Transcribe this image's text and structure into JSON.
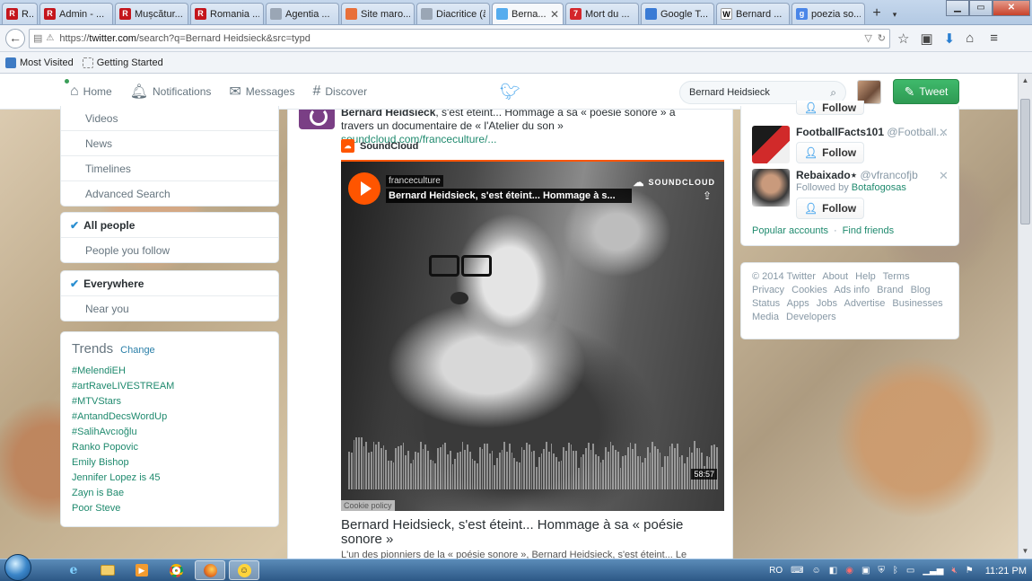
{
  "browser": {
    "tabs": [
      {
        "title": "R...",
        "color": "#c4151c",
        "glyph": "R"
      },
      {
        "title": "Admin - ...",
        "color": "#c4151c",
        "glyph": "R"
      },
      {
        "title": "Mușcătur...",
        "color": "#c4151c",
        "glyph": "R"
      },
      {
        "title": "Romania ...",
        "color": "#c4151c",
        "glyph": "R"
      },
      {
        "title": "Agentia ...",
        "color": "#9aa6b5",
        "glyph": ""
      },
      {
        "title": "Site maro...",
        "color": "#e8703a",
        "glyph": ""
      },
      {
        "title": "Diacritice (ăâî...",
        "color": "#9aa6b5",
        "glyph": ""
      },
      {
        "title": "Berna...",
        "color": "#55acee",
        "glyph": "",
        "active": true
      },
      {
        "title": "Mort du ...",
        "color": "#d4262b",
        "glyph": "7"
      },
      {
        "title": "Google T...",
        "color": "#3a7bd5",
        "glyph": ""
      },
      {
        "title": "Bernard ...",
        "color": "#ffffff",
        "glyph": "W"
      },
      {
        "title": "poezia so...",
        "color": "#4a86e8",
        "glyph": "g"
      }
    ],
    "url_prefix": "https://",
    "url_host": "twitter.com",
    "url_rest": "/search?q=Bernard Heidsieck&src=typd",
    "bookmarks": [
      "Most Visited",
      "Getting Started"
    ]
  },
  "twitter": {
    "nav": {
      "home": "Home",
      "notifications": "Notifications",
      "messages": "Messages",
      "discover": "Discover"
    },
    "search_value": "Bernard Heidsieck",
    "tweet_button": "Tweet",
    "filters_top": [
      "Videos",
      "News",
      "Timelines",
      "Advanced Search"
    ],
    "people_filter": {
      "selected": "All people",
      "other": "People you follow"
    },
    "location_filter": {
      "selected": "Everywhere",
      "other": "Near you"
    },
    "trends": {
      "title": "Trends",
      "change": "Change",
      "items": [
        "#MelendiEH",
        "#artRaveLIVESTREAM",
        "#MTVStars",
        "#AntandDecsWordUp",
        "#SalihAvcıoğlu",
        "Ranko Popovic",
        "Emily Bishop",
        "Jennifer Lopez is 45",
        "Zayn is Bae",
        "Poor Steve"
      ]
    },
    "tweet": {
      "name": "Bernard Heidsieck",
      "text": ", s'est éteint... Hommage à sa « poésie sonore » à travers un documentaire de « l'Atelier du son » ",
      "link": "soundcloud.com/franceculture/...",
      "source_label": "SoundCloud",
      "player": {
        "user": "franceculture",
        "title": "Bernard Heidsieck, s'est éteint... Hommage à s...",
        "brand": "SOUNDCLOUD",
        "duration": "58:57",
        "cookie": "Cookie policy"
      },
      "card_title": "Bernard Heidsieck, s'est éteint... Hommage à sa « poésie sonore »",
      "card_desc": "L'un des pionniers de la « poésie sonore », Bernard Heidsieck, s'est éteint... Le"
    },
    "who_to_follow": {
      "partial_follow": "Follow",
      "items": [
        {
          "name": "FootballFacts101",
          "handle": "@Football...",
          "follow": "Follow"
        },
        {
          "name": "Rebaixado⋆",
          "handle": "@vfrancofjb",
          "followed_by_prefix": "Followed by",
          "followed_by": "Botafogosas",
          "follow": "Follow"
        }
      ],
      "popular": "Popular accounts",
      "find": "Find friends"
    },
    "footer": [
      "© 2014 Twitter",
      "About",
      "Help",
      "Terms",
      "Privacy",
      "Cookies",
      "Ads info",
      "Brand",
      "Blog",
      "Status",
      "Apps",
      "Jobs",
      "Advertise",
      "Businesses",
      "Media",
      "Developers"
    ]
  },
  "taskbar": {
    "lang": "RO",
    "time": "11:21 PM"
  }
}
